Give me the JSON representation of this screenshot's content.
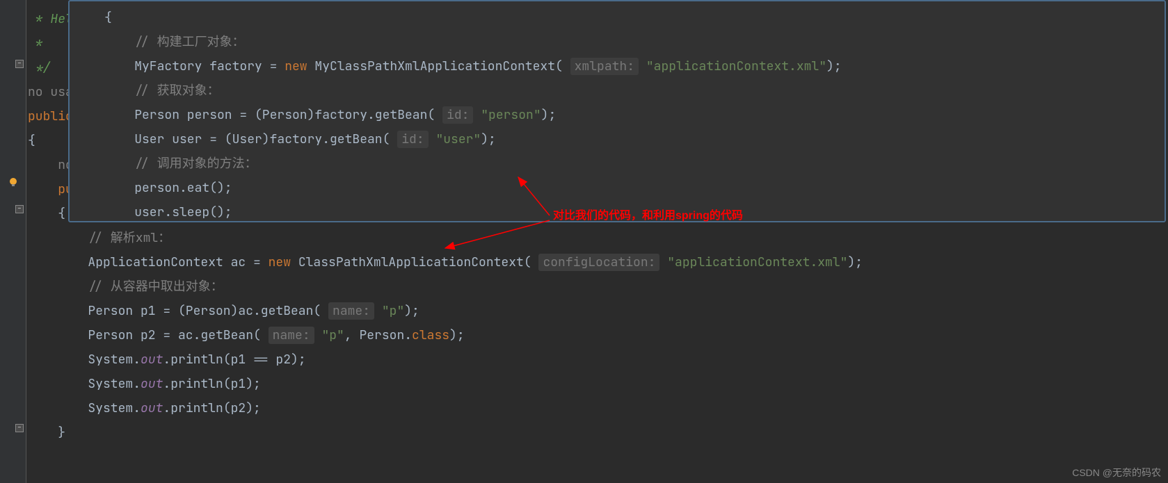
{
  "gutter": {
    "no_usages": "no usag",
    "no_usages2": "no"
  },
  "comments": {
    "doc_hello": " * Hel",
    "doc_star": " *",
    "doc_end": " */",
    "build_factory": "// 构建工厂对象：",
    "get_object": "// 获取对象：",
    "call_method": "// 调用对象的方法：",
    "parse_xml": "// 解析xml：",
    "get_from_container": "// 从容器中取出对象："
  },
  "keywords": {
    "public": "public",
    "public2": "pu",
    "new": "new",
    "class_kw": "class"
  },
  "code": {
    "brace_open": "{",
    "brace_close": "}",
    "factory_decl_1": "MyFactory factory = ",
    "factory_decl_2": " MyClassPathXmlApplicationContext(",
    "factory_decl_3": ");",
    "xmlpath_hint": "xmlpath:",
    "xmlpath_value": "\"applicationContext.xml\"",
    "person_decl_1": "Person person = (Person)factory.getBean(",
    "person_decl_2": ");",
    "id_hint": "id:",
    "person_value": "\"person\"",
    "user_decl_1": "User user = (User)factory.getBean(",
    "user_value": "\"user\"",
    "user_decl_2": ");",
    "person_eat": "person.eat();",
    "user_sleep": "user.sleep();",
    "ac_decl_1": "ApplicationContext ac = ",
    "ac_decl_2": " ClassPathXmlApplicationContext(",
    "configLocation_hint": "configLocation:",
    "ac_value": "\"applicationContext.xml\"",
    "ac_decl_3": ");",
    "p1_decl_1": "Person p1 = (Person)ac.getBean(",
    "name_hint": "name:",
    "p_value": "\"p\"",
    "p1_decl_2": ");",
    "p2_decl_1": "Person p2 = ac.getBean(",
    "p2_decl_2": ", Person.",
    "p2_decl_3": ");",
    "sout1_1": "System.",
    "out": "out",
    "sout1_2": ".println(p1 == p2);",
    "sout2_2": ".println(p1);",
    "sout3_2": ".println(p2);"
  },
  "annotations": {
    "compare_text": "对比我们的代码，和利用spring的代码"
  },
  "watermark": "CSDN @无奈的码农"
}
